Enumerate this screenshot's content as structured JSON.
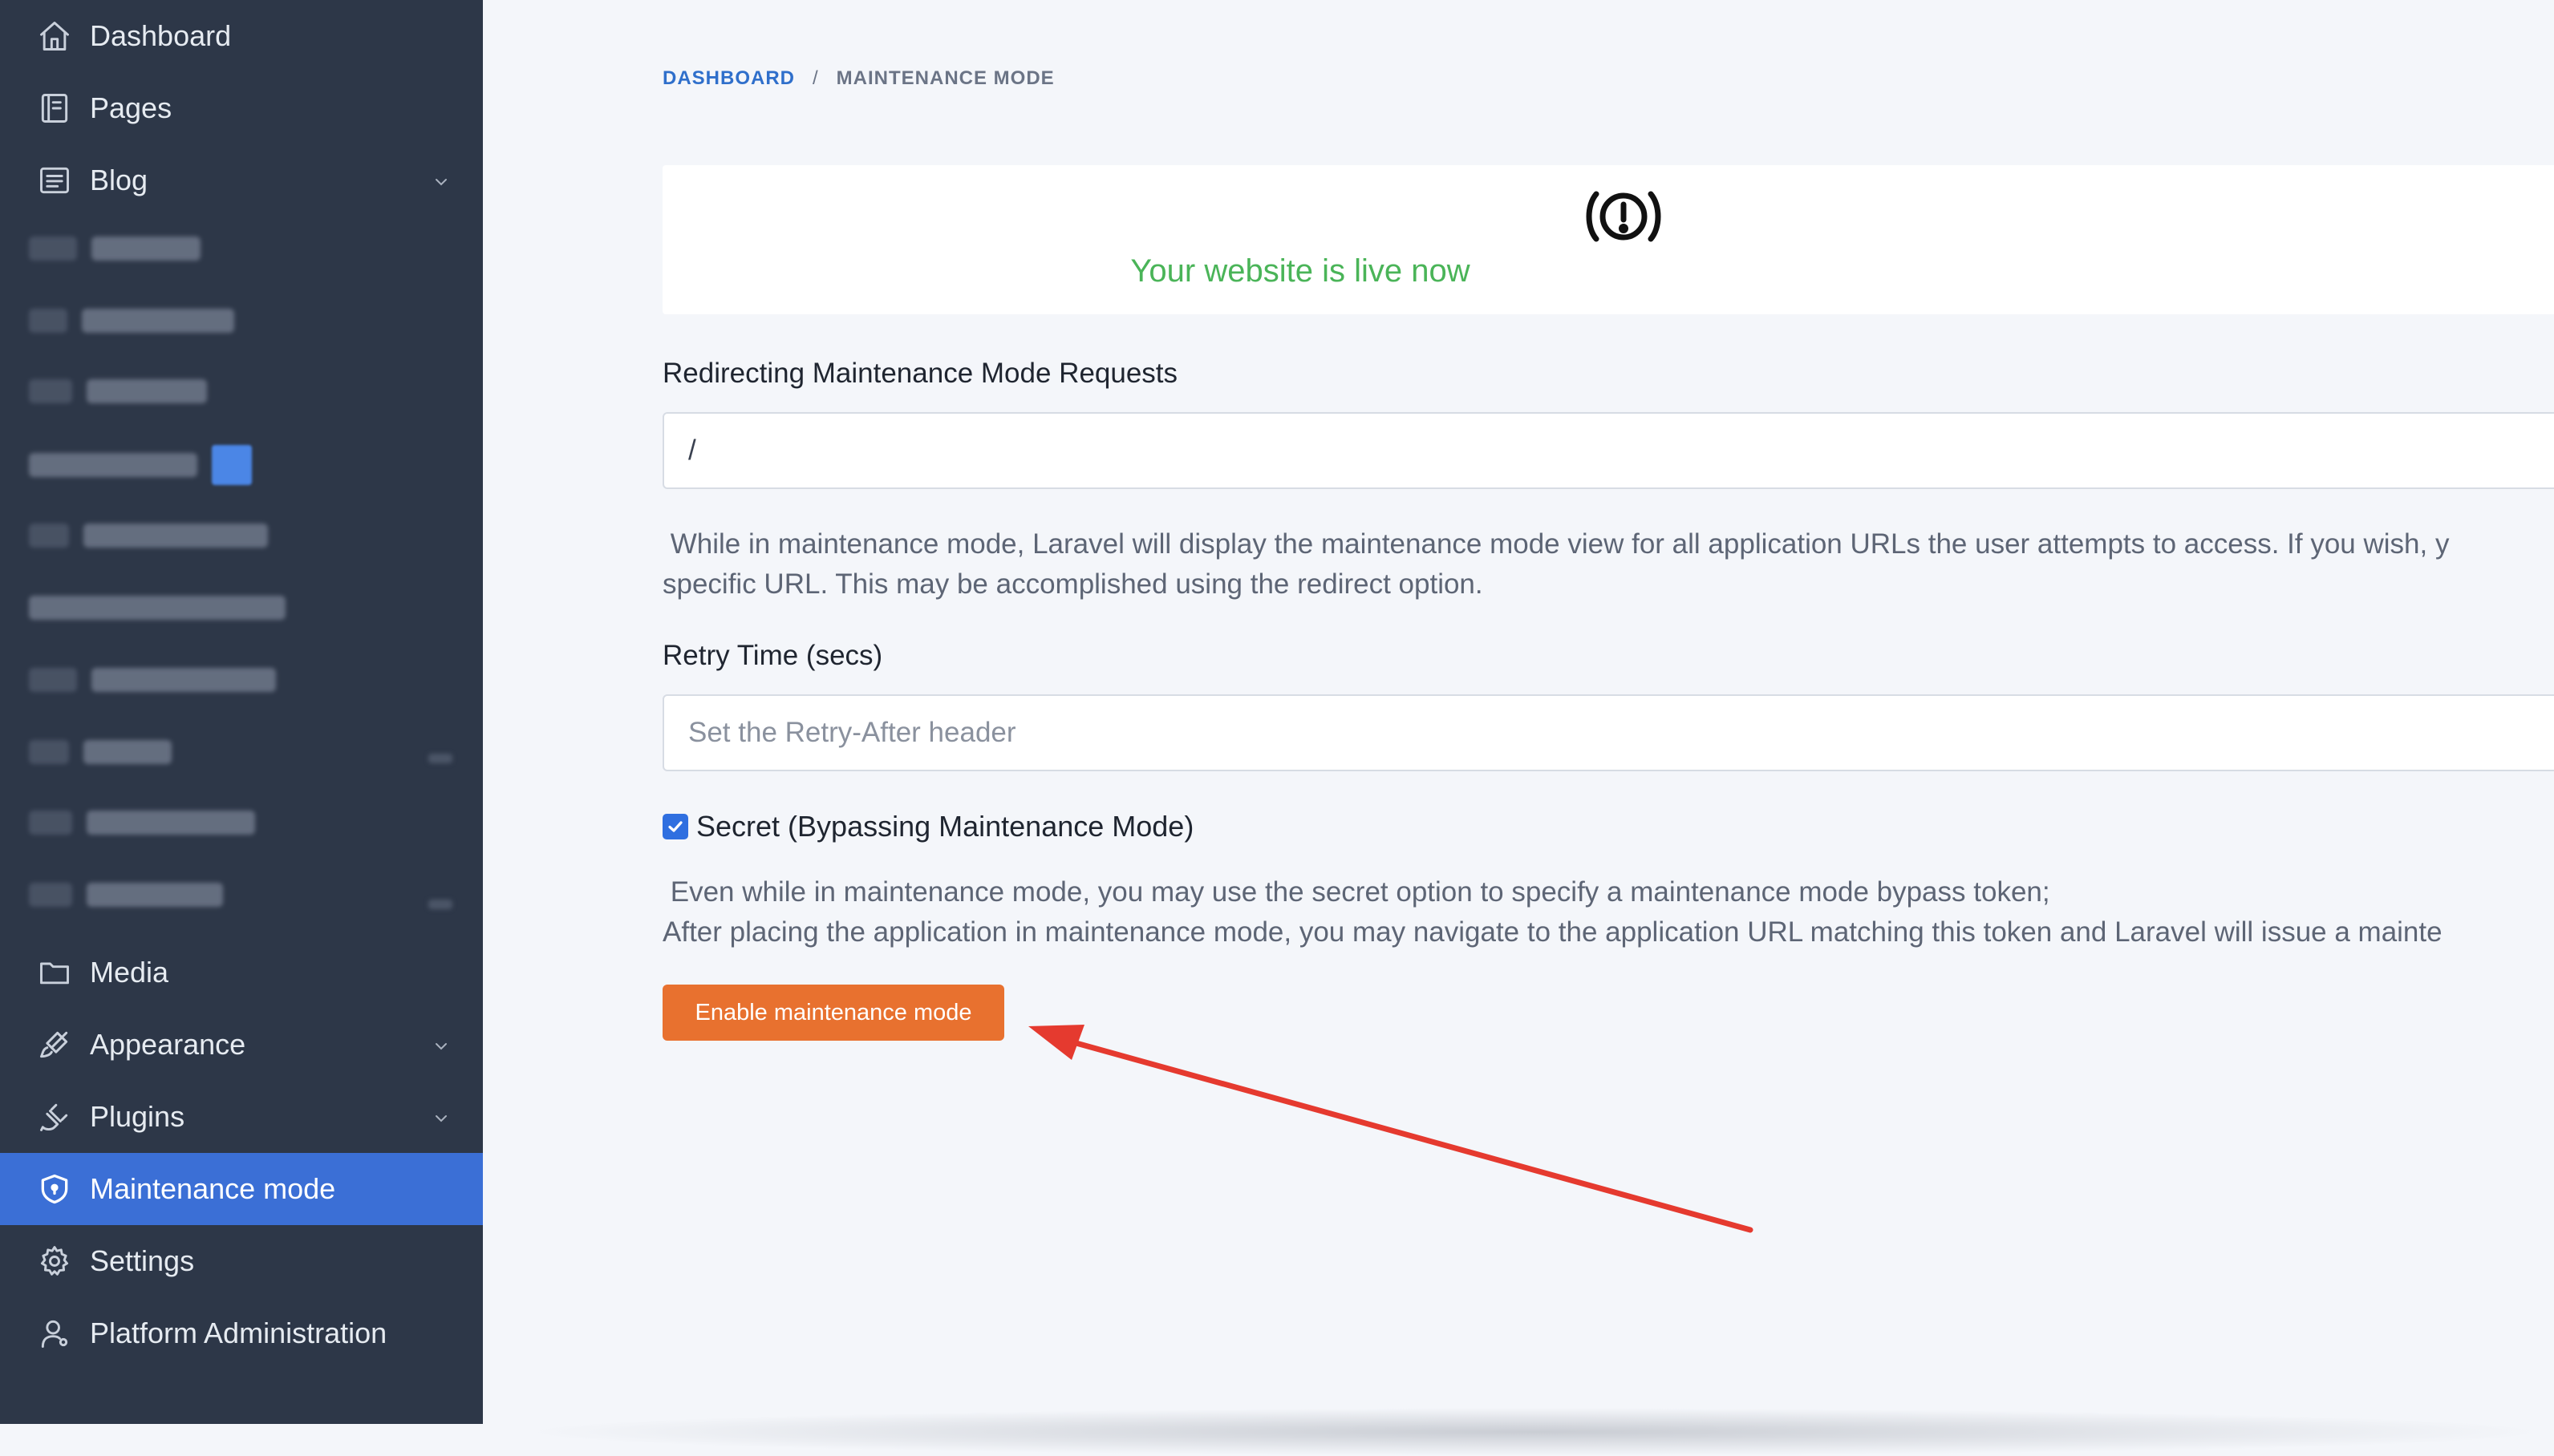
{
  "sidebar": {
    "items": [
      {
        "label": "Dashboard",
        "icon": "home-icon"
      },
      {
        "label": "Pages",
        "icon": "book-icon"
      },
      {
        "label": "Blog",
        "icon": "list-icon",
        "has_children": true
      },
      {
        "label": "Media",
        "icon": "folder-icon"
      },
      {
        "label": "Appearance",
        "icon": "brush-icon",
        "has_children": true
      },
      {
        "label": "Plugins",
        "icon": "plug-icon",
        "has_children": true
      },
      {
        "label": "Maintenance mode",
        "icon": "shield-icon",
        "active": true
      },
      {
        "label": "Settings",
        "icon": "gear-icon"
      },
      {
        "label": "Platform Administration",
        "icon": "user-icon"
      }
    ]
  },
  "breadcrumb": {
    "home": "DASHBOARD",
    "separator": "/",
    "current": "MAINTENANCE MODE"
  },
  "status": {
    "text": "Your website is live now",
    "color": "#4ab458"
  },
  "redirect": {
    "label": "Redirecting Maintenance Mode Requests",
    "value": "/",
    "help_line1": " While in maintenance mode, Laravel will display the maintenance mode view for all application URLs the user attempts to access. If you wish, y",
    "help_line2": "specific URL. This may be accomplished using the redirect option."
  },
  "retry": {
    "label": "Retry Time (secs)",
    "placeholder": "Set the Retry-After header"
  },
  "secret": {
    "label": "Secret (Bypassing Maintenance Mode)",
    "checked": true,
    "help_line1": " Even while in maintenance mode, you may use the secret option to specify a maintenance mode bypass token;",
    "help_line2": "After placing the application in maintenance mode, you may navigate to the application URL matching this token and Laravel will issue a mainte"
  },
  "actions": {
    "enable_label": "Enable maintenance mode",
    "primary_color": "#e8712f"
  },
  "theme": {
    "sidebar_bg": "#2d3748",
    "active_bg": "#3b6fd6",
    "link_color": "#2f6fcb",
    "annotation_color": "#e53a2f"
  }
}
